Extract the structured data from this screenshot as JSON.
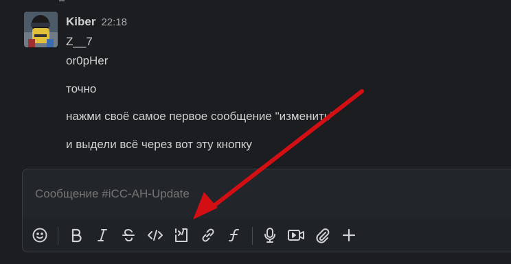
{
  "message": {
    "author": "Kiber",
    "time": "22:18",
    "lines": [
      "Z__7",
      "or0pHer",
      "точно",
      "нажми своё самое первое сообщение \"изменить\"",
      "и выдели всё через вот эту кнопку"
    ]
  },
  "composer": {
    "placeholder": "Сообщение #iCC-AH-Update"
  },
  "toolbar": {
    "icons": [
      "emoji-icon",
      "bold-icon",
      "italic-icon",
      "strikethrough-icon",
      "code-icon",
      "code-block-icon",
      "link-icon",
      "function-icon",
      "microphone-icon",
      "video-icon",
      "attachment-icon",
      "plus-icon"
    ]
  },
  "colors": {
    "background": "#1b1d21",
    "text": "#d1d2d3",
    "muted": "#ababad",
    "annotation_arrow": "#d40f14"
  }
}
